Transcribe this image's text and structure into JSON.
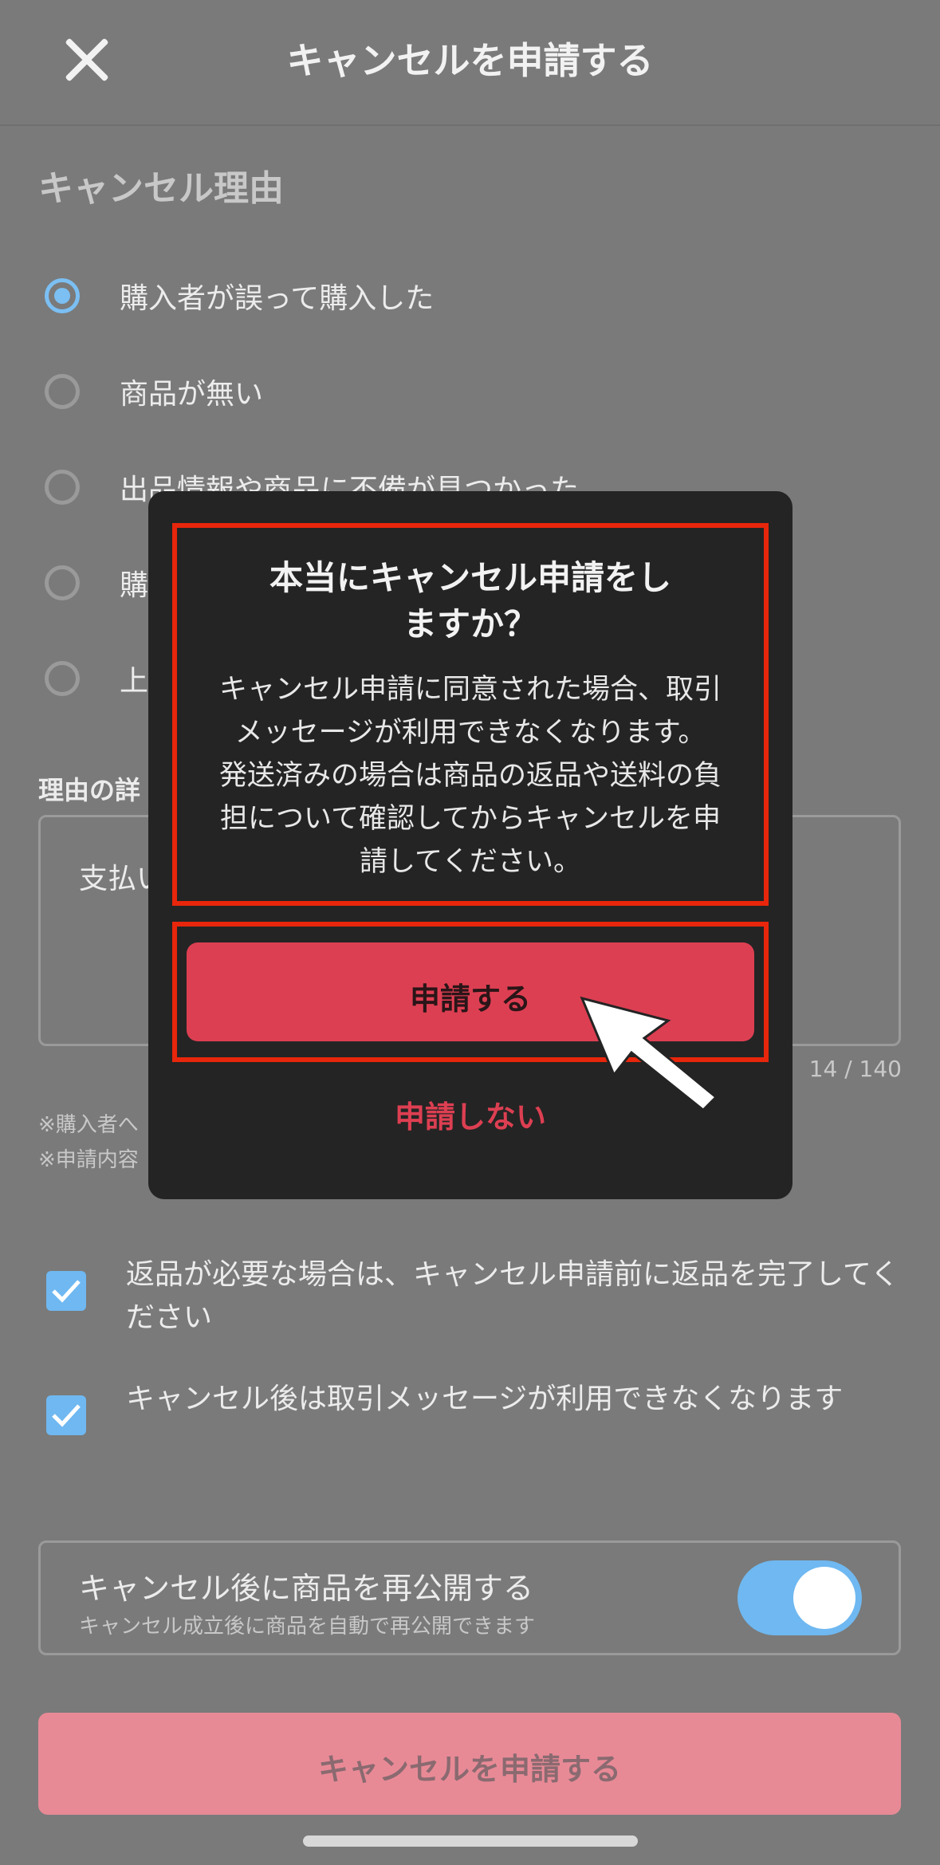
{
  "header": {
    "title": "キャンセルを申請する"
  },
  "reason_section": {
    "title": "キャンセル理由",
    "options": [
      {
        "label": "購入者が誤って購入した",
        "selected": true
      },
      {
        "label": "商品が無い",
        "selected": false
      },
      {
        "label": "出品情報や商品に不備が見つかった",
        "selected": false
      },
      {
        "label": "購",
        "selected": false
      },
      {
        "label": "上",
        "selected": false
      }
    ]
  },
  "detail": {
    "title": "理由の詳",
    "value": "支払い",
    "counter": "14 / 140"
  },
  "notes": [
    "※購入者へ",
    "※申請内容"
  ],
  "checks": [
    {
      "label": "返品が必要な場合は、キャンセル申請前に返品を完了してください",
      "checked": true
    },
    {
      "label": "キャンセル後は取引メッセージが利用できなくなります",
      "checked": true
    }
  ],
  "relist": {
    "title": "キャンセル後に商品を再公開する",
    "subtitle": "キャンセル成立後に商品を自動で再公開できます",
    "on": true
  },
  "submit": {
    "label": "キャンセルを申請する"
  },
  "modal": {
    "title_line1": "本当にキャンセル申請をし",
    "title_line2": "ますか？",
    "body_lines": [
      "キャンセル申請に同意された場合、取引",
      "メッセージが利用できなくなります。",
      "発送済みの場合は商品の返品や送料の負",
      "担について確認してからキャンセルを申",
      "請してください。"
    ],
    "confirm_label": "申請する",
    "cancel_label": "申請しない"
  },
  "colors": {
    "accent_red": "#dd3f52",
    "highlight_red": "#e8260c",
    "accent_blue": "#6fb8f1"
  }
}
